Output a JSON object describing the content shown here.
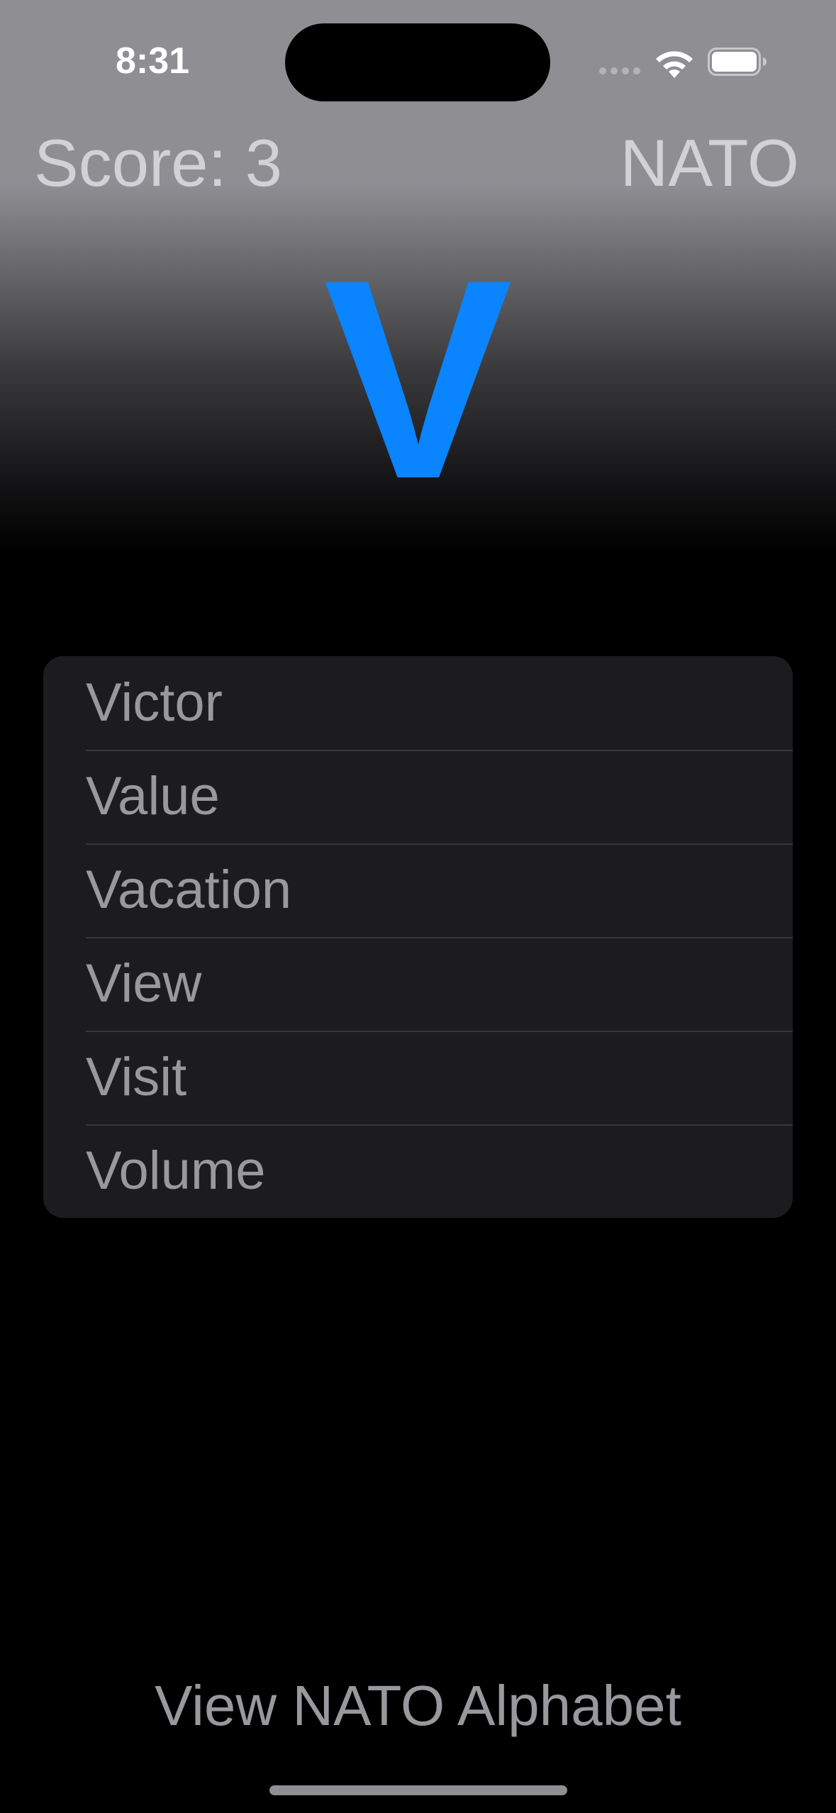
{
  "status_bar": {
    "time": "8:31",
    "icons": [
      "cellular-signal-icon",
      "wifi-icon",
      "battery-icon"
    ]
  },
  "header": {
    "score_text": "Score: 3",
    "mode_label": "NATO"
  },
  "prompt_letter": "V",
  "options": [
    {
      "label": "Victor"
    },
    {
      "label": "Value"
    },
    {
      "label": "Vacation"
    },
    {
      "label": "View"
    },
    {
      "label": "Visit"
    },
    {
      "label": "Volume"
    }
  ],
  "footer": {
    "view_alphabet_label": "View NATO Alphabet"
  },
  "colors": {
    "accent": "#0a84ff",
    "list_background": "#1c1c1e",
    "secondary_text": "#98989d",
    "header_text": "#d1d1d6"
  }
}
